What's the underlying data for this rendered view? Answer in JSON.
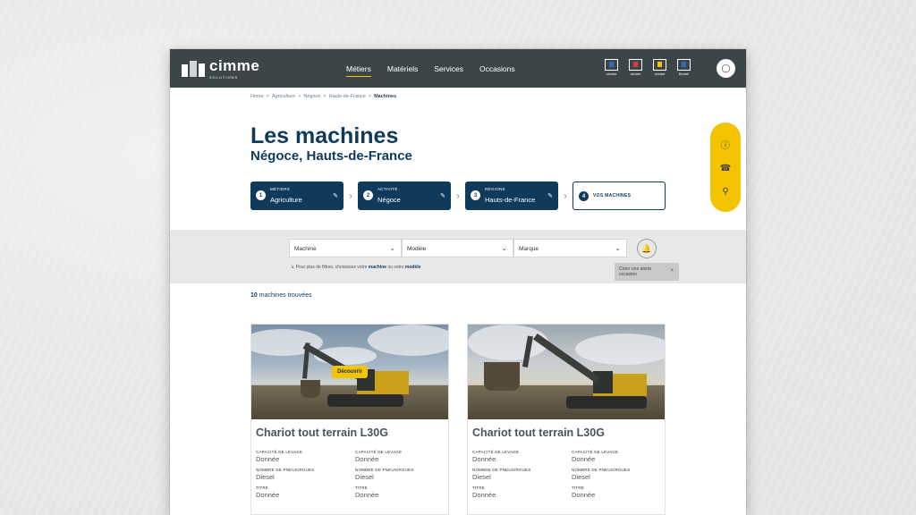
{
  "header": {
    "logo_word": "cimme",
    "logo_sub": "SOLUTIONS",
    "nav": [
      {
        "label": "Métiers",
        "active": true
      },
      {
        "label": "Matériels"
      },
      {
        "label": "Services"
      },
      {
        "label": "Occasions"
      }
    ],
    "brands": [
      {
        "name": "cimme",
        "color": "#2d6fb8"
      },
      {
        "name": "cimme",
        "color": "#d83a3a"
      },
      {
        "name": "cimme",
        "color": "#f4c400"
      },
      {
        "name": "Bomel",
        "color": "#2d6fb8"
      }
    ],
    "user_icon": "user-icon"
  },
  "breadcrumb": [
    "Home",
    "Agriculture",
    "Négoce",
    "Hauts-de-France",
    "Machines"
  ],
  "page": {
    "title": "Les machines",
    "subtitle": "Négoce, Hauts-de-France"
  },
  "steps": [
    {
      "num": "1",
      "label": "MÉTIERS",
      "value": "Agriculture"
    },
    {
      "num": "2",
      "label": "ACTIVITÉ",
      "value": "Négoce"
    },
    {
      "num": "3",
      "label": "RÉGIONS",
      "value": "Hauts-de-France"
    },
    {
      "num": "4",
      "value": "VOS MACHINES"
    }
  ],
  "side_icons": [
    "help-icon",
    "phone-icon",
    "location-pin-icon"
  ],
  "filters": {
    "selects": [
      "Machine",
      "Modèle",
      "Marque"
    ],
    "hint_prefix": "Pour plus de filtres, choisissez votre",
    "hint_machine": "machine",
    "hint_or": "ou votre",
    "hint_model": "modèle",
    "alert_tip": "Créer une alerte occasion",
    "alert_close": "×"
  },
  "results": {
    "count": "10",
    "label": "machines trouvées"
  },
  "cards": [
    {
      "name": "Chariot tout terrain L30G",
      "cta": "Découvrir",
      "specs": [
        {
          "k": "CAPACITÉ DE LEVAGE",
          "v": "Donnée"
        },
        {
          "k": "CAPACITÉ DE LEVAGE",
          "v": "Donnée"
        },
        {
          "k": "NOMBRE DE PNEUS/ROUES",
          "v": "Diesel"
        },
        {
          "k": "NOMBRE DE PNEUS/ROUES",
          "v": "Diesel"
        },
        {
          "k": "TITRE",
          "v": "Donnée"
        },
        {
          "k": "TITRE",
          "v": "Donnée"
        }
      ]
    },
    {
      "name": "Chariot tout terrain L30G",
      "specs": [
        {
          "k": "CAPACITÉ DE LEVAGE",
          "v": "Donnée"
        },
        {
          "k": "CAPACITÉ DE LEVAGE",
          "v": "Donnée"
        },
        {
          "k": "NOMBRE DE PNEUS/ROUES",
          "v": "Diesel"
        },
        {
          "k": "NOMBRE DE PNEUS/ROUES",
          "v": "Diesel"
        },
        {
          "k": "TITRE",
          "v": "Donnée"
        },
        {
          "k": "TITRE",
          "v": "Donnée"
        }
      ]
    }
  ]
}
